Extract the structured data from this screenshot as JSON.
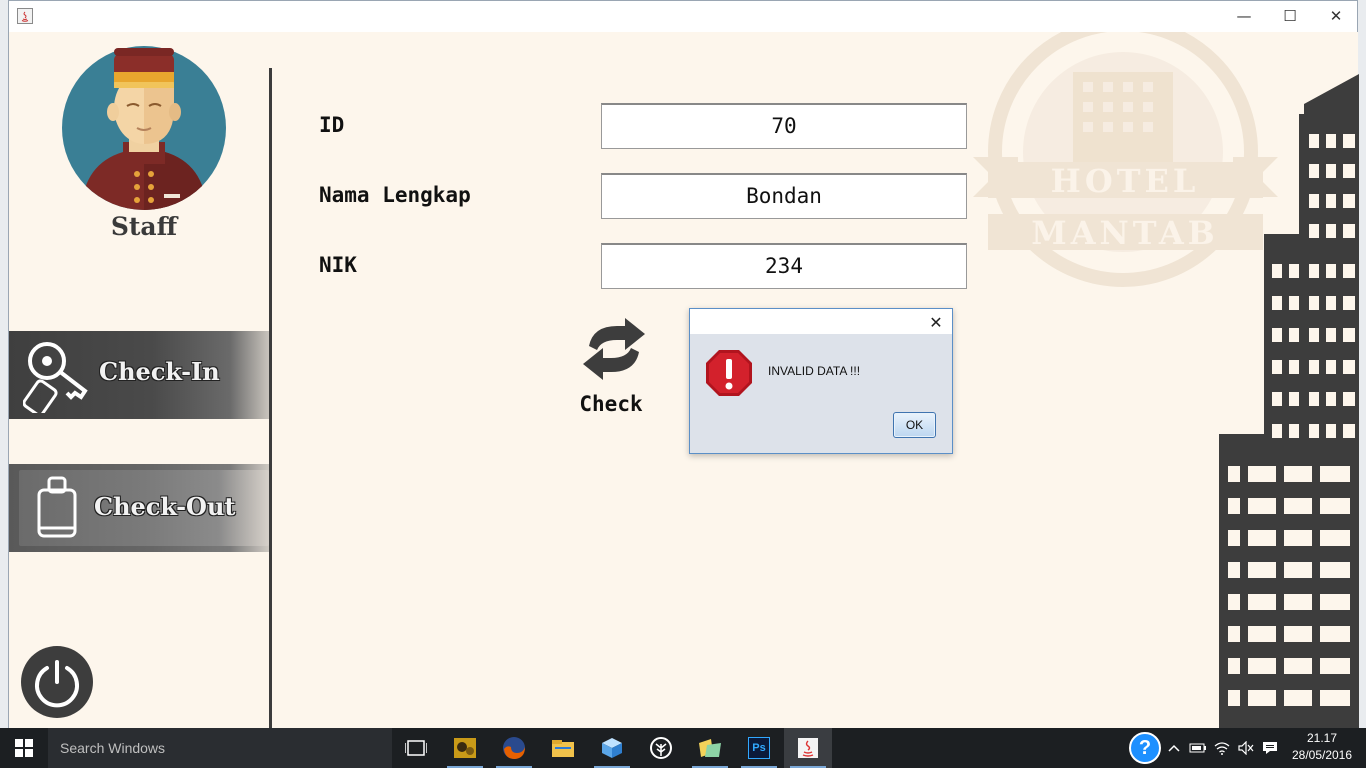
{
  "window": {
    "title": "",
    "controls": {
      "minimize": "—",
      "maximize": "☐",
      "close": "✕"
    }
  },
  "sidebar": {
    "role_label": "Staff",
    "checkin_label": "Check-In",
    "checkout_label": "Check-Out"
  },
  "form": {
    "fields": [
      {
        "label": "ID",
        "value": "70"
      },
      {
        "label": "Nama Lengkap",
        "value": "Bondan"
      },
      {
        "label": "NIK",
        "value": "234"
      }
    ],
    "check_label": "Check"
  },
  "watermark": {
    "line1": "HOTEL",
    "line2": "MANTAB"
  },
  "dialog": {
    "title": "",
    "message": "INVALID DATA !!!",
    "ok_label": "OK",
    "close": "✕"
  },
  "taskbar": {
    "search_placeholder": "Search Windows",
    "time": "21.17",
    "date": "28/05/2016",
    "pinned": [
      "task-view-icon",
      "game-icon",
      "firefox-icon",
      "file-explorer-icon",
      "cube-app-icon",
      "tree-app-icon",
      "folder-app-icon",
      "photoshop-icon",
      "java-icon"
    ],
    "photoshop_label": "Ps"
  },
  "colors": {
    "background": "#fdf6ec",
    "dark": "#3d3d3d",
    "avatar_circle": "#3a7f95",
    "uniform": "#7d2a26",
    "dialog_error": "#d3212c",
    "taskbar": "#1c1f22"
  }
}
